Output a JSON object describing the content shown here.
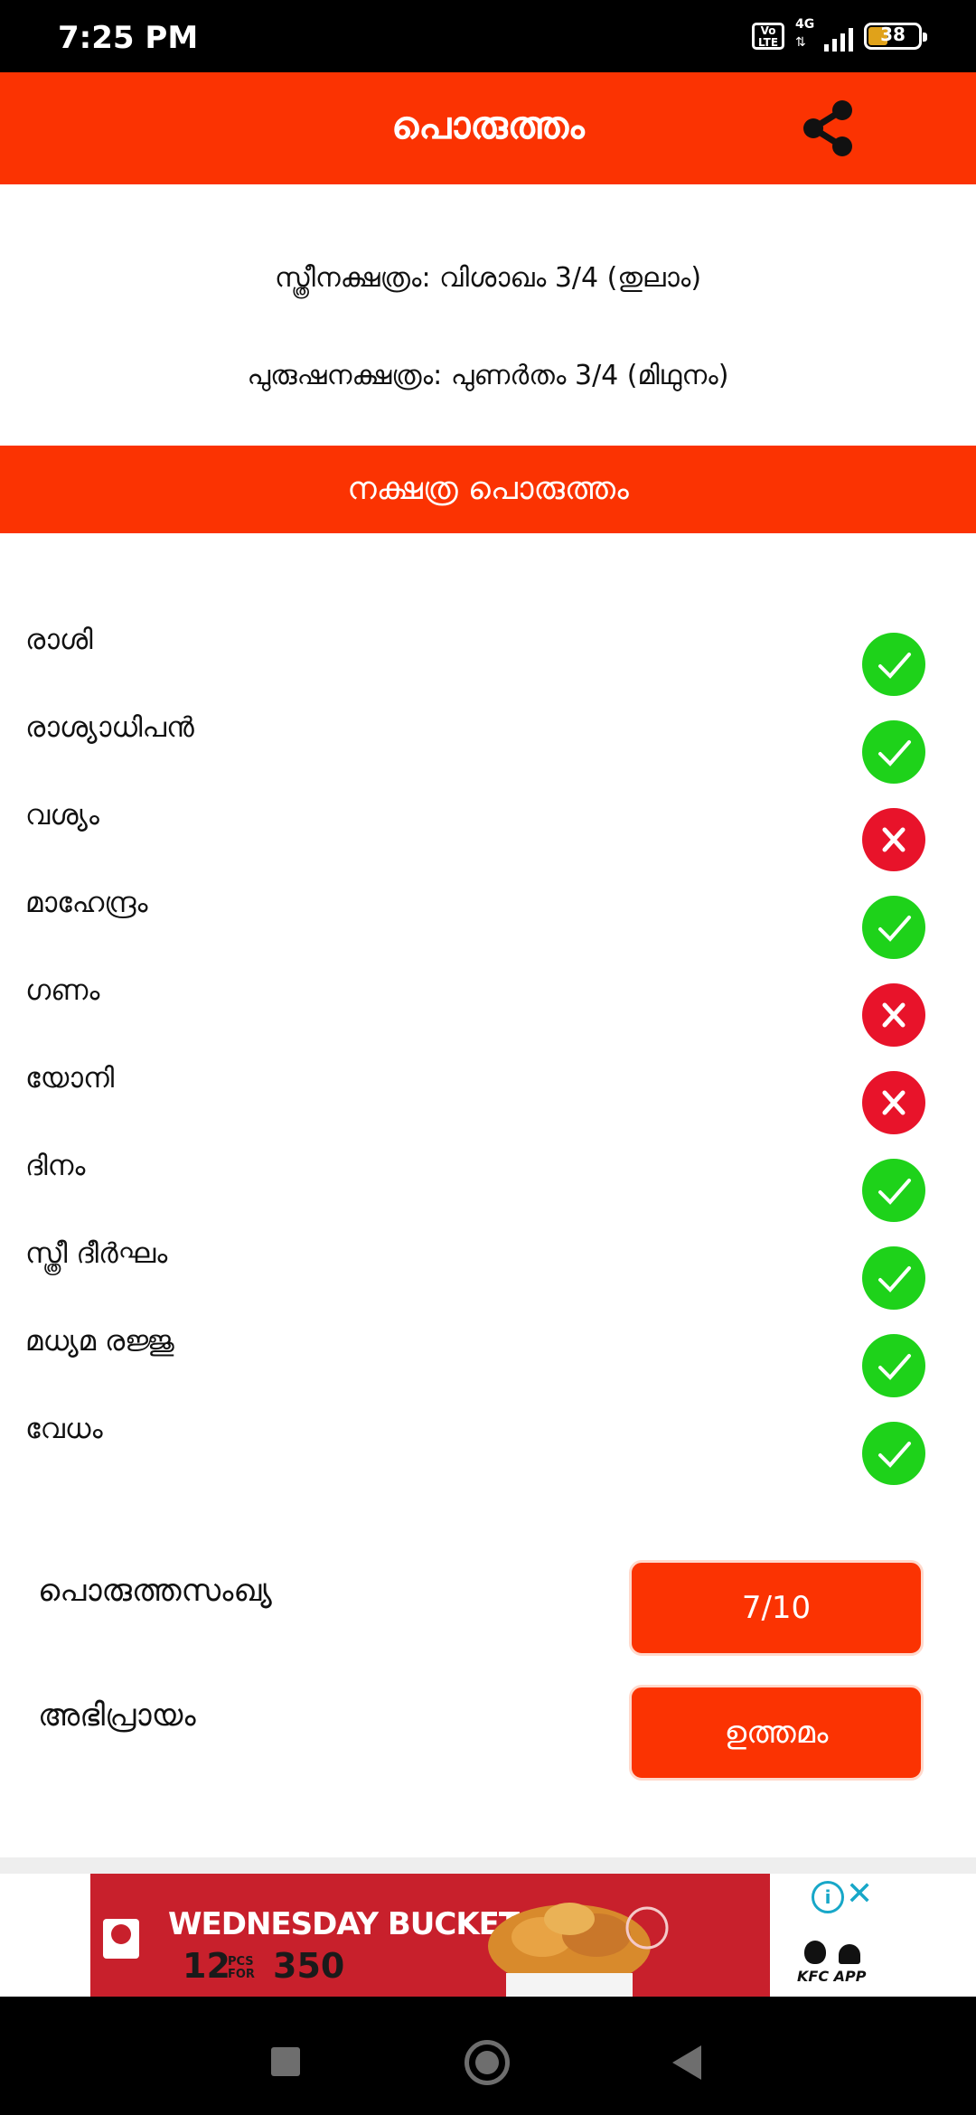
{
  "status_bar": {
    "time": "7:25 PM",
    "volte": "Vo LTE",
    "network": "4G",
    "battery": "38"
  },
  "app_bar": {
    "title": "പൊരുത്തം"
  },
  "info": {
    "female_star": "സ്ത്രീനക്ഷത്രം: വിശാഖം 3/4 (തുലാം)",
    "male_star": "പുരുഷനക്ഷത്രം: പുണർതം 3/4 (മിഥുനം)"
  },
  "section": {
    "title": "നക്ഷത്ര പൊരുത്തം"
  },
  "poruthams": [
    {
      "label": "രാശി",
      "match": true
    },
    {
      "label": "രാശ്യാധിപൻ",
      "match": true
    },
    {
      "label": "വശ്യം",
      "match": false
    },
    {
      "label": "മാഹേന്ദ്രം",
      "match": true
    },
    {
      "label": "ഗണം",
      "match": false
    },
    {
      "label": "യോനി",
      "match": false
    },
    {
      "label": "ദിനം",
      "match": true
    },
    {
      "label": "സ്ത്രീ ദീർഘം",
      "match": true
    },
    {
      "label": "മധ്യമ രജ്ജു",
      "match": true
    },
    {
      "label": "വേധം",
      "match": true
    }
  ],
  "summary": {
    "count_label": "പൊരുത്തസംഖ്യ",
    "count_value": "7/10",
    "opinion_label": "അഭിപ്രായം",
    "opinion_value": "ഉത്തമം"
  },
  "ad": {
    "headline": "WEDNESDAY BUCKET",
    "count_prefix": "12",
    "count_unit": "PCS FOR",
    "price": "350",
    "app_label": "KFC APP"
  },
  "colors": {
    "accent": "#fb3302",
    "ok": "#1ed21a",
    "no": "#e8132a"
  }
}
